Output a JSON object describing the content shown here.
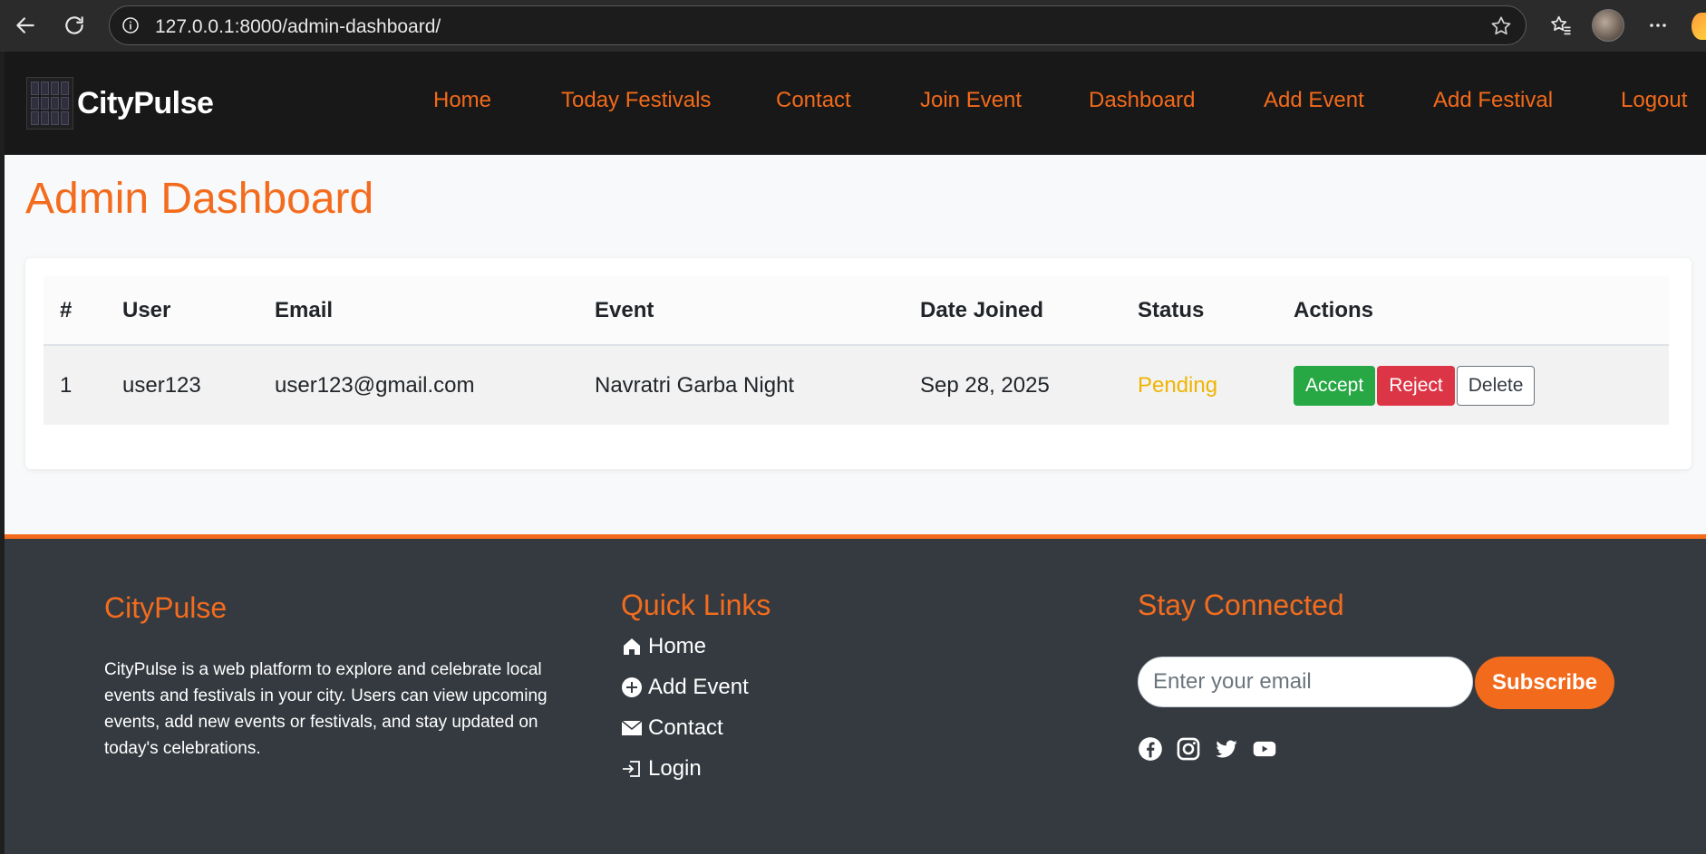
{
  "browser": {
    "url": "127.0.0.1:8000/admin-dashboard/"
  },
  "navbar": {
    "brand": "CityPulse",
    "links": [
      "Home",
      "Today Festivals",
      "Contact",
      "Join Event",
      "Dashboard",
      "Add Event",
      "Add Festival",
      "Logout"
    ]
  },
  "page": {
    "title": "Admin Dashboard"
  },
  "table": {
    "headers": [
      "#",
      "User",
      "Email",
      "Event",
      "Date Joined",
      "Status",
      "Actions"
    ],
    "rows": [
      {
        "num": "1",
        "user": "user123",
        "email": "user123@gmail.com",
        "event": "Navratri Garba Night",
        "date_joined": "Sep 28, 2025",
        "status": "Pending",
        "actions": [
          "Accept",
          "Reject",
          "Delete"
        ]
      }
    ]
  },
  "footer": {
    "about_title": "CityPulse",
    "about_text": "CityPulse is a web platform to explore and celebrate local events and festivals in your city. Users can view upcoming events, add new events or festivals, and stay updated on today's celebrations.",
    "quick_links_title": "Quick Links",
    "quick_links": [
      {
        "label": "Home",
        "icon": "house-icon"
      },
      {
        "label": "Add Event",
        "icon": "plus-circle-icon"
      },
      {
        "label": "Contact",
        "icon": "envelope-icon"
      },
      {
        "label": "Login",
        "icon": "login-icon"
      }
    ],
    "stay_connected_title": "Stay Connected",
    "email_placeholder": "Enter your email",
    "subscribe_label": "Subscribe",
    "social": [
      "facebook-icon",
      "instagram-icon",
      "twitter-icon",
      "youtube-icon"
    ]
  },
  "colors": {
    "accent": "#f26a1b",
    "navbar_bg": "#181818",
    "footer_bg": "#343a40",
    "pending": "#f0b400",
    "accept": "#28a745",
    "reject": "#dc3545"
  }
}
